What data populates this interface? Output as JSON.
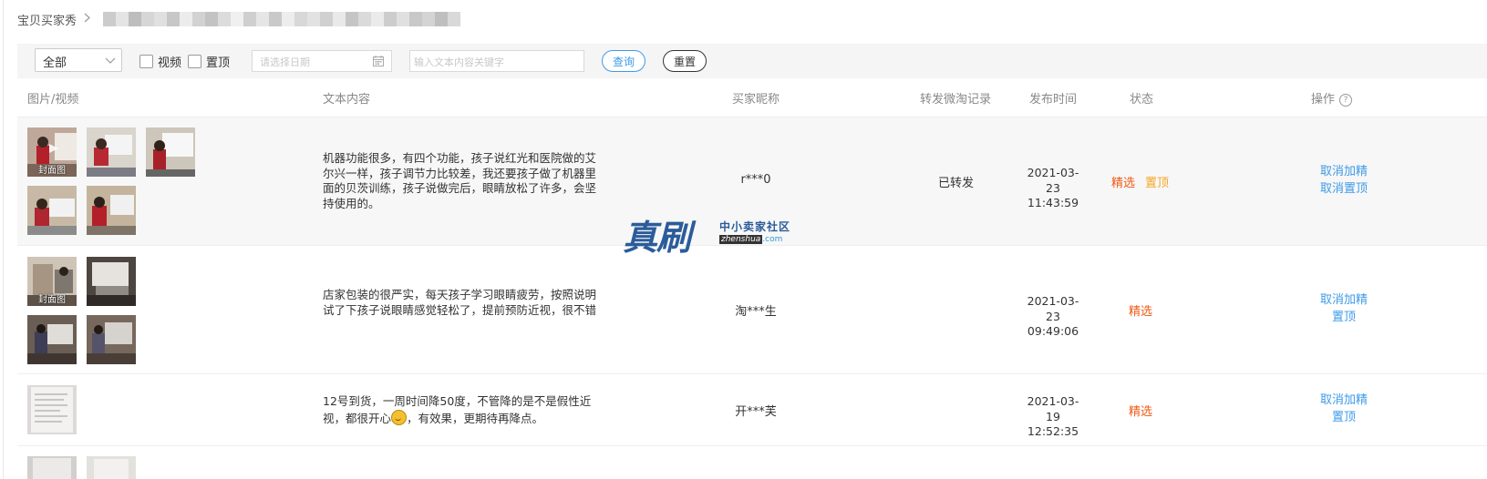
{
  "breadcrumb": {
    "home": "宝贝买家秀",
    "separator": ">"
  },
  "filters": {
    "scope_selected": "全部",
    "video_label": "视频",
    "pin_label": "置顶",
    "date_placeholder": "请选择日期",
    "keyword_placeholder": "输入文本内容关键字",
    "query_label": "查询",
    "reset_label": "重置"
  },
  "columns": {
    "media": "图片/视频",
    "text": "文本内容",
    "nickname": "买家昵称",
    "forward": "转发微淘记录",
    "time": "发布时间",
    "status": "状态",
    "action": "操作"
  },
  "rows": [
    {
      "text": "机器功能很多，有四个功能，孩子说红光和医院做的艾尔兴一样，孩子调节力比较差，我还要孩子做了机器里面的贝茨训练，孩子说做完后，眼睛放松了许多，会坚持使用的。",
      "nickname": "r***0",
      "forward": "已转发",
      "date": "2021-03-23",
      "time": "11:43:59",
      "status": [
        "精选",
        "置顶"
      ],
      "actions": [
        "取消加精",
        "取消置顶"
      ],
      "cover_label": "封面图"
    },
    {
      "text": "店家包装的很严实，每天孩子学习眼睛疲劳，按照说明试了下孩子说眼睛感觉轻松了，提前预防近视，很不错",
      "nickname": "淘***生",
      "date": "2021-03-23",
      "time": "09:49:06",
      "status": [
        "精选"
      ],
      "actions": [
        "取消加精",
        "置顶"
      ],
      "cover_label": "封面图"
    },
    {
      "text_part1": "12号到货，一周时间降50度，不管降的是不是假性近视，都很开心",
      "text_part2": "，有效果，更期待再降点。",
      "nickname": "开***芙",
      "date": "2021-03-19",
      "time": "12:52:35",
      "status": [
        "精选"
      ],
      "actions": [
        "取消加精",
        "置顶"
      ]
    }
  ],
  "watermark": {
    "big": "真刷",
    "cn": "中小卖家社区",
    "domain": "zhenshua",
    "tld": ".com"
  },
  "colors": {
    "link": "#3e9ae8",
    "featured": "#ef5a14",
    "pinned": "#f5a623",
    "watermark": "#2b5c9a"
  }
}
